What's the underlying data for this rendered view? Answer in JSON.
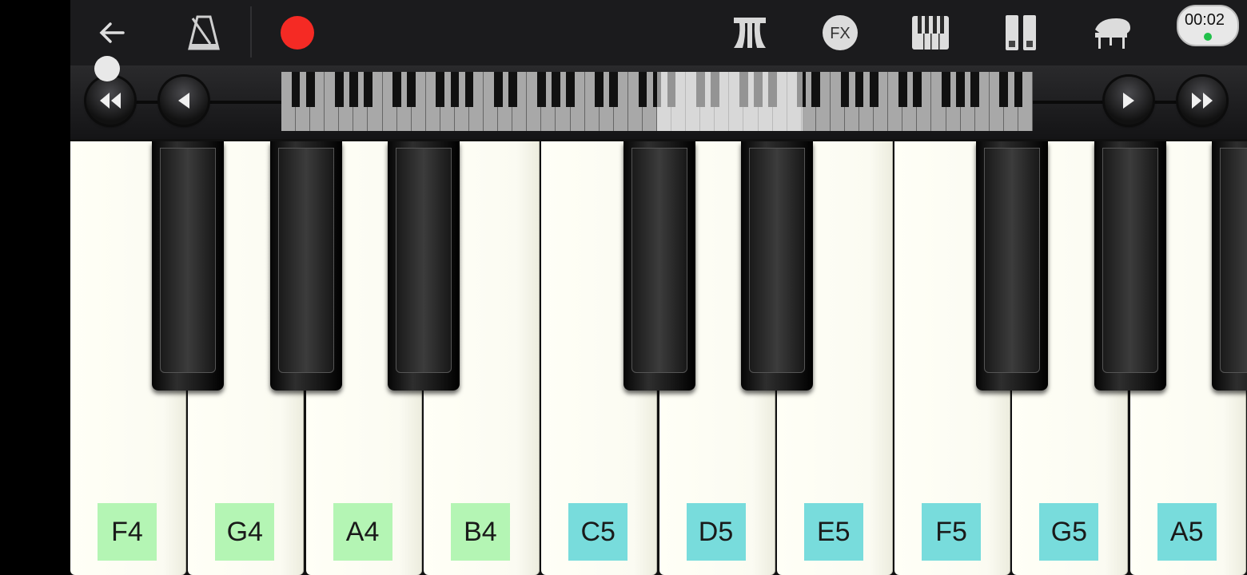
{
  "topbar": {
    "back": "back-arrow-icon",
    "metronome": "metronome-icon",
    "record": "record-icon",
    "tools": [
      "chord-icon",
      "fx-icon",
      "keyboard-layout-icon",
      "dual-keyboard-icon",
      "grand-piano-icon"
    ],
    "fx_label": "FX"
  },
  "navigation": {
    "buttons": [
      "rewind-icon",
      "previous-icon",
      "next-icon",
      "fast-forward-icon"
    ]
  },
  "screen_recorder": {
    "time": "00:02"
  },
  "keyboard": {
    "white_keys": [
      {
        "note": "F4",
        "label_color": "#b4f5b4"
      },
      {
        "note": "G4",
        "label_color": "#b4f5b4"
      },
      {
        "note": "A4",
        "label_color": "#b4f5b4"
      },
      {
        "note": "B4",
        "label_color": "#b4f5b4"
      },
      {
        "note": "C5",
        "label_color": "#78dcdc"
      },
      {
        "note": "D5",
        "label_color": "#78dcdc"
      },
      {
        "note": "E5",
        "label_color": "#78dcdc"
      },
      {
        "note": "F5",
        "label_color": "#78dcdc"
      },
      {
        "note": "G5",
        "label_color": "#78dcdc"
      },
      {
        "note": "A5",
        "label_color": "#78dcdc"
      }
    ]
  },
  "colors": {
    "record": "#f52a24",
    "octave4": "#b4f5b4",
    "octave5": "#78dcdc"
  }
}
